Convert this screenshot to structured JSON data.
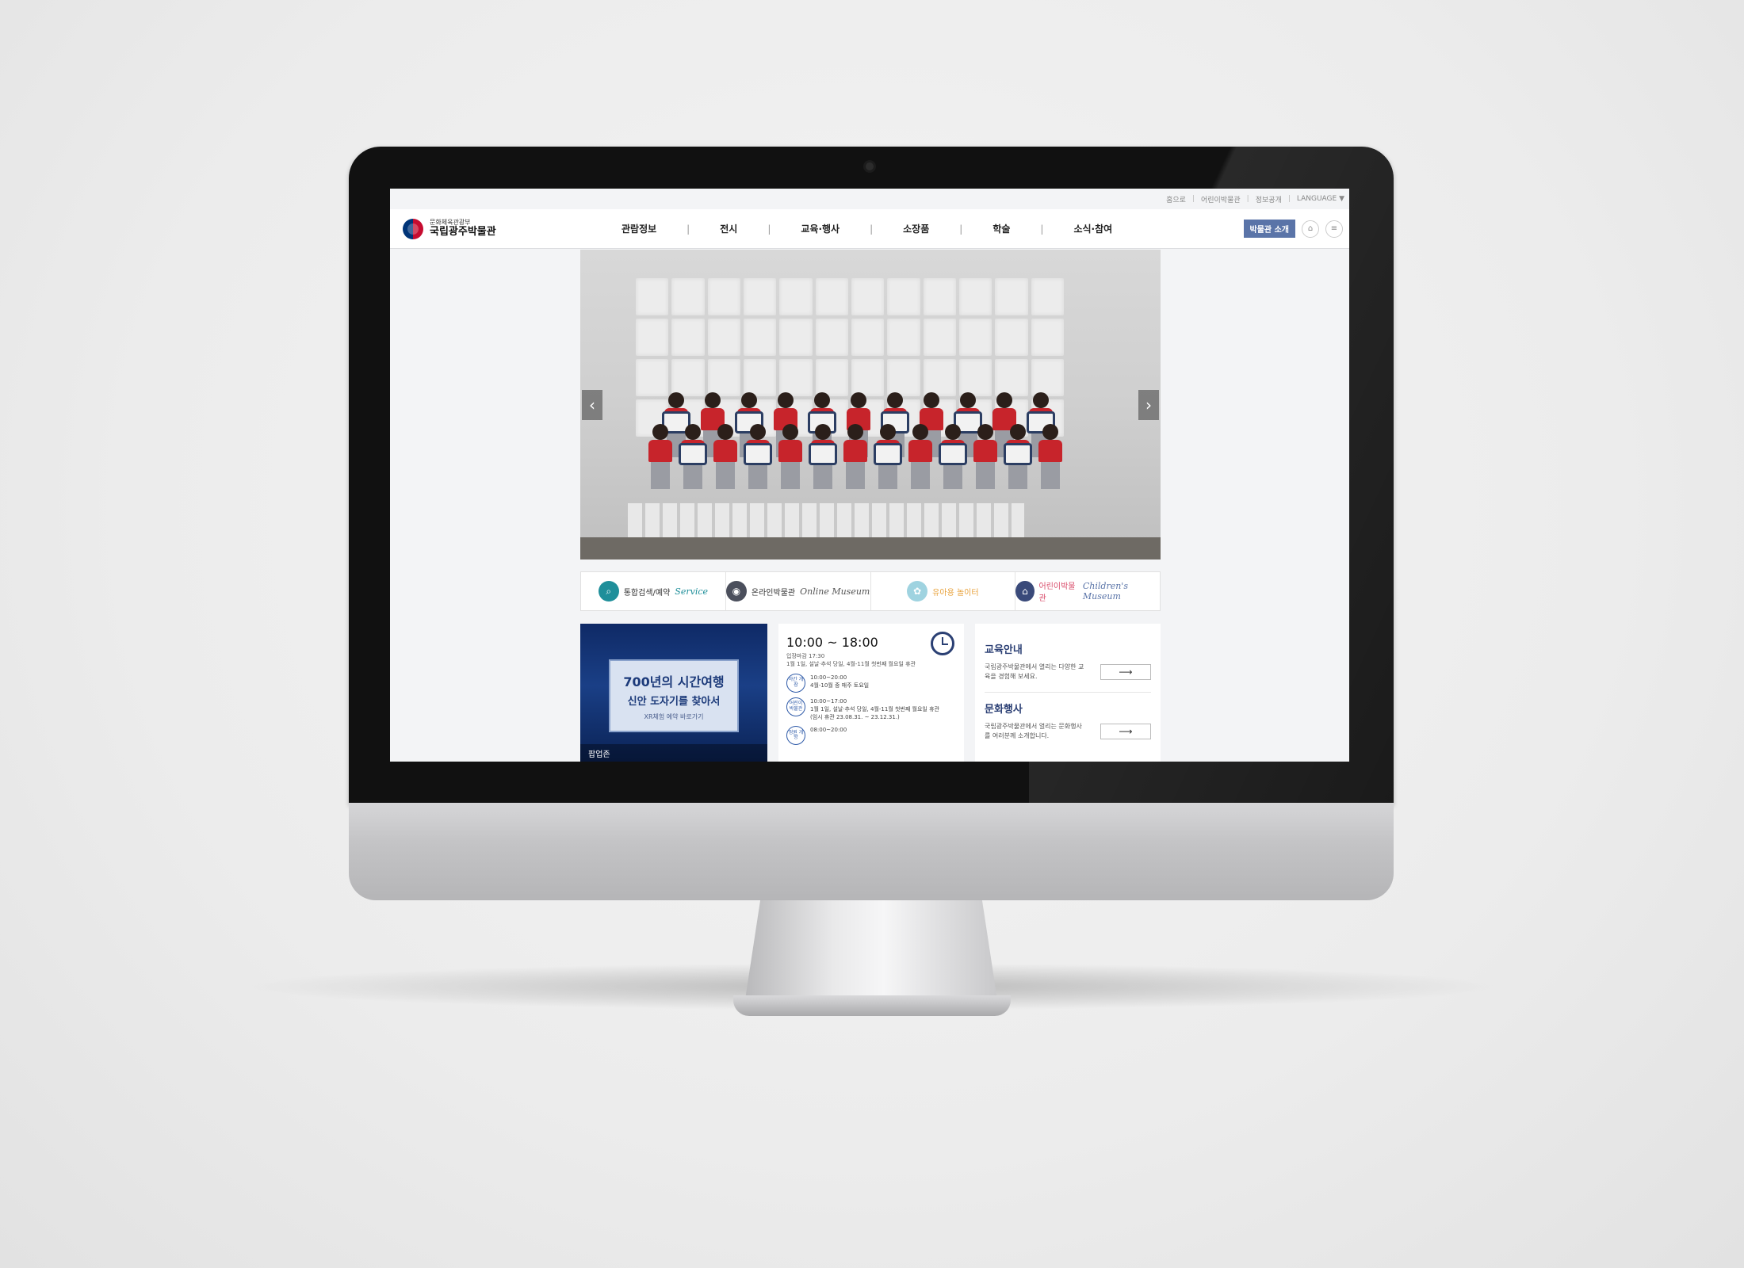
{
  "utility": {
    "items": [
      "홈으로",
      "어린이박물관",
      "정보공개",
      "LANGUAGE ▼"
    ]
  },
  "header": {
    "logo_sub": "문화체육관광부",
    "logo_main": "국립광주박물관",
    "nav": [
      "관람정보",
      "전시",
      "교육·행사",
      "소장품",
      "학술",
      "소식·참여"
    ],
    "intro_button": "박물관 소개"
  },
  "quicklinks": [
    {
      "label": "통합검색/예약",
      "script": "Service",
      "icon": "search-icon",
      "color": "#1f8f9a"
    },
    {
      "label": "온라인박물관",
      "script": "Online Museum",
      "icon": "user-pin-icon",
      "color": "#4b4f5c"
    },
    {
      "label": "유아용 놀이터",
      "script": "",
      "icon": "shell-icon",
      "color": "#9fd3e0"
    },
    {
      "label": "어린이박물관",
      "script": "Children's Museum",
      "icon": "house-icon",
      "color": "#3a4a7a"
    }
  ],
  "popup": {
    "title": "700년의 시간여행",
    "subtitle": "신안 도자기를 찾아서",
    "link": "XR체험 예약 바로가기",
    "label": "팝업존"
  },
  "hours": {
    "time": "10:00 ~ 18:00",
    "last_entry": "입장마감 17:30",
    "closed": "1월 1일, 설날·추석 당일, 4월-11월 첫번째 월요일 휴관",
    "rows": [
      {
        "badge": "야간 개장",
        "lines": [
          "10:00~20:00",
          "4월-10월 중 매주 토요일"
        ]
      },
      {
        "badge": "어린이 박물관",
        "lines": [
          "10:00~17:00",
          "1월 1일, 설날·추석 당일, 4월-11월 첫번째 월요일 휴관",
          "(임시 휴관 23.08.31. ~ 23.12.31.)"
        ]
      },
      {
        "badge": "정원 개방",
        "lines": [
          "08:00~20:00"
        ]
      }
    ]
  },
  "edu": [
    {
      "title": "교육안내",
      "desc": "국립광주박물관에서 열리는 다양한 교육을 경험해 보세요."
    },
    {
      "title": "문화행사",
      "desc": "국립광주박물관에서 열리는 문화행사를 여러분께 소개합니다."
    }
  ],
  "colors": {
    "accent": "#5a74a8",
    "navy": "#2b3f74"
  }
}
